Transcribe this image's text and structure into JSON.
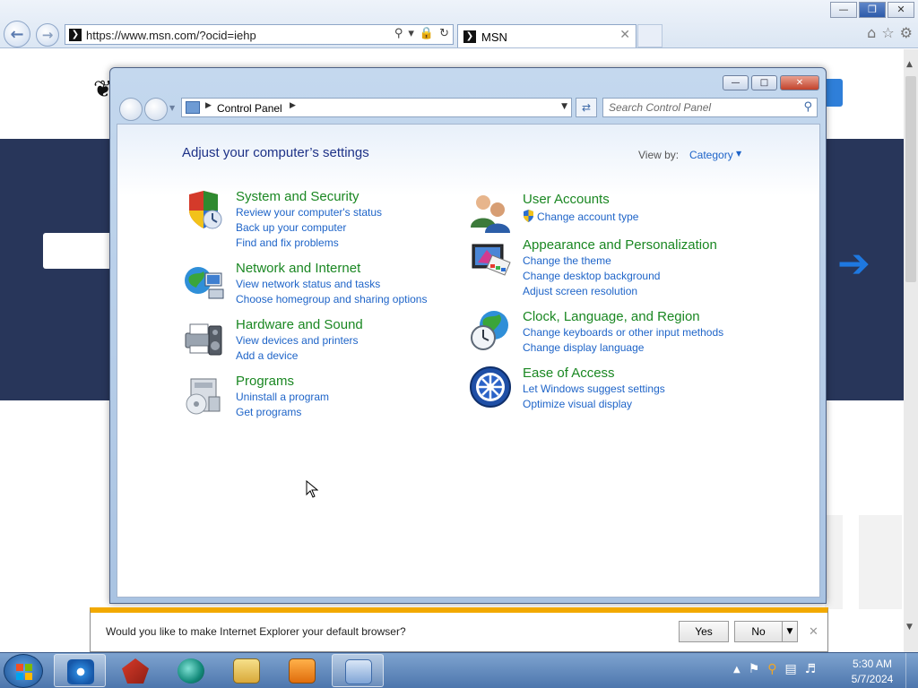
{
  "browser": {
    "url": "https://www.msn.com/?ocid=iehp",
    "tab_title": "MSN",
    "site_icon": "msn-favicon"
  },
  "control_panel": {
    "breadcrumb": "Control Panel",
    "search_placeholder": "Search Control Panel",
    "heading": "Adjust your computer’s settings",
    "view_by_label": "View by:",
    "view_by_value": "Category",
    "categories": [
      {
        "title": "System and Security",
        "icon": "shield-icon",
        "links": [
          "Review your computer's status",
          "Back up your computer",
          "Find and fix problems"
        ]
      },
      {
        "title": "Network and Internet",
        "icon": "network-globe-icon",
        "links": [
          "View network status and tasks",
          "Choose homegroup and sharing options"
        ]
      },
      {
        "title": "Hardware and Sound",
        "icon": "printer-speaker-icon",
        "links": [
          "View devices and printers",
          "Add a device"
        ]
      },
      {
        "title": "Programs",
        "icon": "programs-disc-icon",
        "links": [
          "Uninstall a program",
          "Get programs"
        ]
      },
      {
        "title": "User Accounts",
        "icon": "users-icon",
        "links": [
          "Change account type"
        ]
      },
      {
        "title": "Appearance and Personalization",
        "icon": "monitor-paint-icon",
        "links": [
          "Change the theme",
          "Change desktop background",
          "Adjust screen resolution"
        ]
      },
      {
        "title": "Clock, Language, and Region",
        "icon": "globe-clock-icon",
        "links": [
          "Change keyboards or other input methods",
          "Change display language"
        ]
      },
      {
        "title": "Ease of Access",
        "icon": "ease-of-access-icon",
        "links": [
          "Let Windows suggest settings",
          "Optimize visual display"
        ]
      }
    ]
  },
  "notification": {
    "message": "Would you like to make Internet Explorer your default browser?",
    "yes_label": "Yes",
    "no_label": "No"
  },
  "taskbar": {
    "time": "5:30 AM",
    "date": "5/7/2024",
    "pinned": [
      "internet-explorer-icon",
      "toolbox-icon",
      "app-circle-icon",
      "file-explorer-icon",
      "media-player-icon",
      "control-panel-icon"
    ]
  }
}
